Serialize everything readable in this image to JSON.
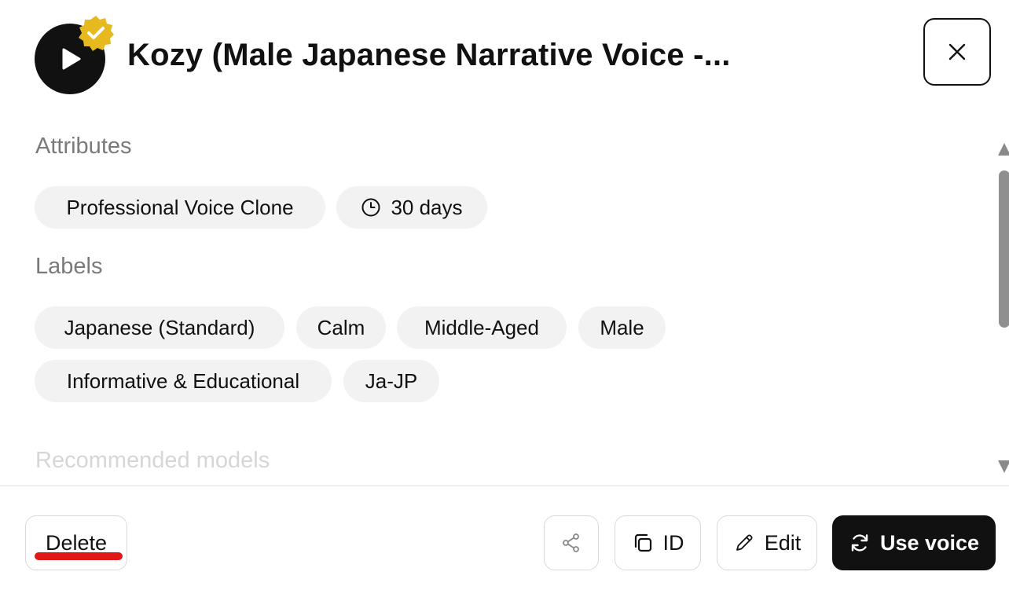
{
  "header": {
    "title": "Kozy (Male Japanese Narrative Voice -...",
    "play_icon": "play-icon",
    "verified_icon": "verified-badge-icon",
    "close_icon": "close-icon"
  },
  "sections": {
    "attributes_title": "Attributes",
    "labels_title": "Labels",
    "models_title": "Recommended models"
  },
  "attributes": [
    {
      "label": "Professional Voice Clone"
    },
    {
      "label": "30 days",
      "icon": "clock-icon"
    }
  ],
  "labels": [
    {
      "label": "Japanese (Standard)"
    },
    {
      "label": "Calm"
    },
    {
      "label": "Middle-Aged"
    },
    {
      "label": "Male"
    },
    {
      "label": "Informative & Educational"
    },
    {
      "label": "Ja-JP"
    }
  ],
  "footer": {
    "delete_label": "Delete",
    "share_icon": "share-icon",
    "id_label": "ID",
    "edit_label": "Edit",
    "use_voice_label": "Use voice"
  },
  "colors": {
    "primary": "#111111",
    "chip_bg": "#f2f2f2",
    "verified_gold": "#e6b91e",
    "section_title": "#7a7a7a",
    "delete_underline": "#e01818"
  }
}
